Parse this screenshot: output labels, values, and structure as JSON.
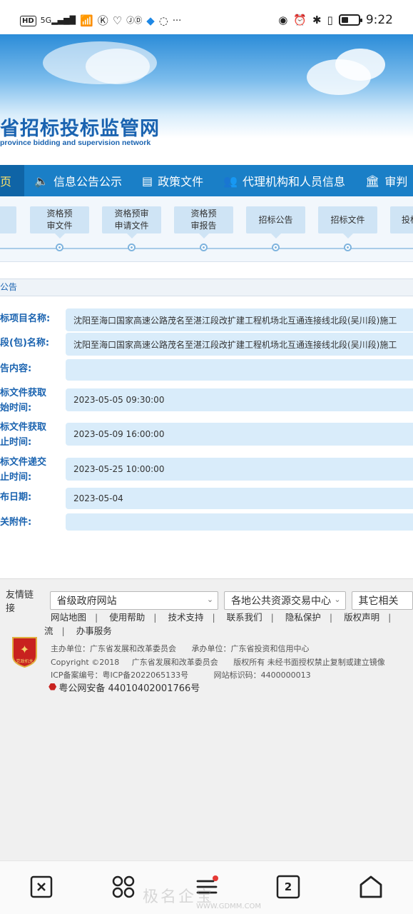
{
  "status_bar": {
    "network": "5G",
    "hd": "HD",
    "more": "···",
    "time": "9:22",
    "battery_level": 0.4
  },
  "banner": {
    "title": "省招标投标监管网",
    "subtitle": "province bidding and supervision network"
  },
  "nav": {
    "items": [
      {
        "label": "页",
        "icon": "home"
      },
      {
        "label": "信息公告公示",
        "icon": "speaker-icon"
      },
      {
        "label": "政策文件",
        "icon": "document-icon"
      },
      {
        "label": "代理机构和人员信息",
        "icon": "users-icon"
      },
      {
        "label": "审判",
        "icon": "bank-icon"
      }
    ]
  },
  "steps": {
    "items": [
      {
        "label": "资格预\n审文件"
      },
      {
        "label": "资格预审\n申请文件"
      },
      {
        "label": "资格预\n审报告"
      },
      {
        "label": "招标公告"
      },
      {
        "label": "招标文件"
      },
      {
        "label": "投标"
      }
    ]
  },
  "section": {
    "title": "公告"
  },
  "details": {
    "rows": [
      {
        "label": "标项目名称:",
        "value": "沈阳至海口国家高速公路茂名至湛江段改扩建工程机场北互通连接线北段(吴川段)施工"
      },
      {
        "label": "段(包)名称:",
        "value": "沈阳至海口国家高速公路茂名至湛江段改扩建工程机场北互通连接线北段(吴川段)施工"
      },
      {
        "label": "告内容:",
        "value": ""
      },
      {
        "label": "标文件获取\n始时间:",
        "value": "2023-05-05 09:30:00"
      },
      {
        "label": "标文件获取\n止时间:",
        "value": "2023-05-09 16:00:00"
      },
      {
        "label": "标文件递交\n止时间:",
        "value": "2023-05-25 10:00:00"
      },
      {
        "label": "布日期:",
        "value": "2023-05-04"
      },
      {
        "label": "关附件:",
        "value": ""
      }
    ]
  },
  "footer": {
    "links_label": "友情链接",
    "select1": "省级政府网站",
    "select2": "各地公共资源交易中心",
    "select3": "其它相关",
    "nav1": [
      "网站地图",
      "使用帮助",
      "技术支持",
      "联系我们",
      "隐私保护",
      "版权声明"
    ],
    "nav2": [
      "流",
      "办事服务"
    ],
    "host": "主办单位：广东省发展和改革委员会",
    "undertaker": "承办单位：广东省投资和信用中心",
    "copyright": "Copyright ©2018",
    "copyright_org": "广东省发展和改革委员会",
    "rights": "版权所有 未经书面授权禁止复制或建立镜像",
    "icp": "ICP备案编号：粤ICP备2022065133号",
    "site_id": "网站标识码：4400000013",
    "police": "粤公网安备 44010402001766号",
    "emblem_text": "党政机关"
  },
  "bottom_nav": {
    "tabs_count": "2",
    "watermark": "极名企宝",
    "watermark_url": "WWW.GDMM.COM"
  }
}
